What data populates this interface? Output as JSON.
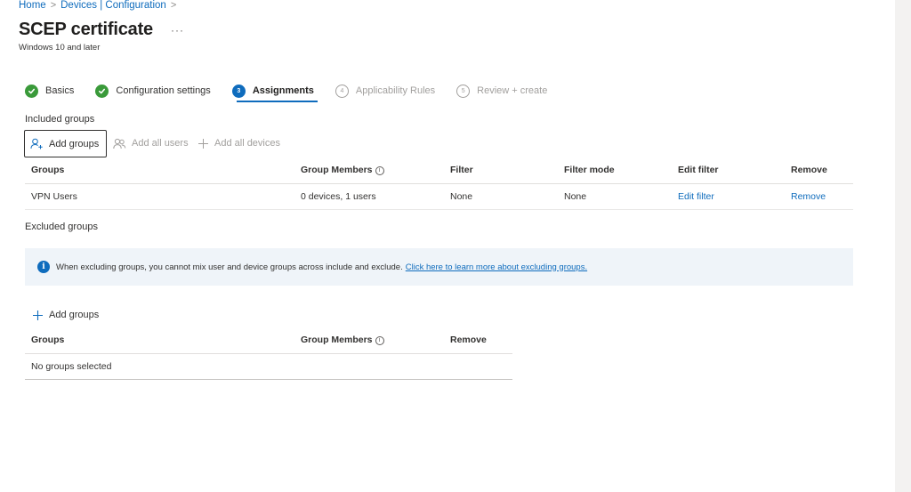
{
  "breadcrumb": {
    "home": "Home",
    "devices": "Devices | Configuration",
    "sep": ">"
  },
  "header": {
    "title": "SCEP certificate",
    "more": "···",
    "subtitle": "Windows 10 and later"
  },
  "steps": [
    {
      "label": "Basics",
      "status": "done",
      "marker": ""
    },
    {
      "label": "Configuration settings",
      "status": "done",
      "marker": ""
    },
    {
      "label": "Assignments",
      "status": "current",
      "marker": "3"
    },
    {
      "label": "Applicability Rules",
      "status": "future",
      "marker": "4"
    },
    {
      "label": "Review + create",
      "status": "future",
      "marker": "5"
    }
  ],
  "included": {
    "label": "Included groups",
    "toolbar": {
      "add_groups": "Add groups",
      "add_all_users": "Add all users",
      "add_all_devices": "Add all devices"
    },
    "columns": [
      "Groups",
      "Group Members",
      "Filter",
      "Filter mode",
      "Edit filter",
      "Remove"
    ],
    "rows": [
      {
        "group": "VPN Users",
        "members": "0 devices, 1 users",
        "filter": "None",
        "filter_mode": "None",
        "edit_filter": "Edit filter",
        "remove": "Remove"
      }
    ]
  },
  "excluded": {
    "label": "Excluded groups",
    "info": {
      "text": "When excluding groups, you cannot mix user and device groups across include and exclude.",
      "link": "Click here to learn more about excluding groups.",
      "icon": "info-icon"
    },
    "toolbar": {
      "add_groups": "Add groups"
    },
    "columns": [
      "Groups",
      "Group Members",
      "Remove"
    ],
    "empty": "No groups selected"
  },
  "colors": {
    "accent": "#0f6cbd",
    "success": "#3a9a3a",
    "info_bg": "#eff4f9",
    "muted": "#a19f9d"
  }
}
